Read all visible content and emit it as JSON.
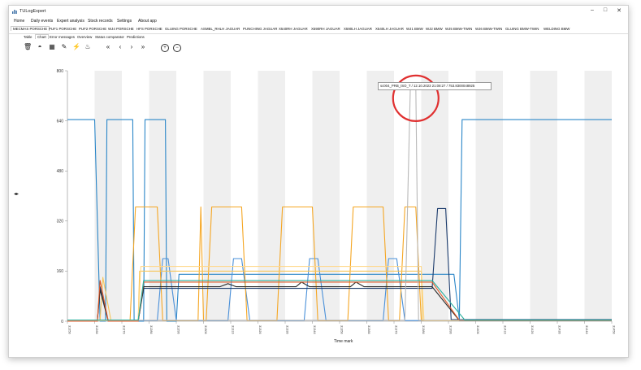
{
  "window": {
    "title": "TULogExpert",
    "controls": [
      "–",
      "□",
      "✕"
    ]
  },
  "menu": [
    "Home",
    "Daily events",
    "Expert analysis",
    "Stock records",
    "Settings",
    "About app"
  ],
  "line_tabs": [
    "MECMAS PORSCHE",
    "PUF1 PORSCHE",
    "PUF2 PORSCHE",
    "WJ4 PORSCHE",
    "HFS PORSCHE",
    "GLUING PORSCHE",
    "ASMBL_RHLH JAGUAR",
    "PUNCHING JAGUAR",
    "X540RH JAGUAR",
    "X590RH JAGUAR",
    "X590LH JAGUAR",
    "X540LH JAGUAR",
    "WJ1 BMW",
    "WJ2 BMW",
    "WJ5 BMW-TWIN",
    "WJ6 BMW-TWIN",
    "GLUING BMW-TWIN",
    "WELDING BMW"
  ],
  "sub_tabs": [
    "Table",
    "Chart",
    "Error messages",
    "Overview",
    "Status comparator",
    "Predictions"
  ],
  "active_sub_tab": "Chart",
  "toolbar_icons": [
    "trash-icon",
    "headset-icon",
    "calendar-icon",
    "edit-icon",
    "bolt-icon",
    "fire-icon",
    "rewind-icon",
    "back-icon",
    "forward-icon",
    "fast-forward-icon",
    "add-icon",
    "minus-icon"
  ],
  "toolbar_glyphs": [
    "🗑",
    "◓",
    "▦",
    "✎",
    "⚡",
    "♨",
    "«",
    "‹",
    "›",
    "»",
    "+",
    "−"
  ],
  "side_handle": "◂▸",
  "tooltip": "sc004_PRB_ISO_T / 12.10.2023 21:08:27 / 753.8300048925",
  "chart_data": {
    "type": "line",
    "xlabel": "Time mark",
    "ylabel": "",
    "yticks": [
      0,
      160,
      320,
      480,
      640,
      800
    ],
    "ylim": [
      0,
      800
    ],
    "xticks": [
      "31256",
      "31266",
      "31276",
      "31286",
      "31296",
      "31306",
      "31316",
      "31326",
      "31336",
      "31346",
      "31356",
      "31366",
      "31376",
      "31386",
      "31396",
      "31406",
      "31416",
      "31426",
      "31436",
      "31446",
      "31456"
    ],
    "xlim": [
      31256,
      31456
    ],
    "grid": "alternating vertical bands",
    "series": [
      {
        "color": "#2a86c8",
        "points": [
          [
            31256,
            644
          ],
          [
            31266,
            644
          ],
          [
            31268,
            0
          ],
          [
            31270,
            0
          ],
          [
            31270.5,
            644
          ],
          [
            31280,
            644
          ],
          [
            31280.5,
            0
          ],
          [
            31284,
            0
          ],
          [
            31284.5,
            644
          ],
          [
            31292,
            644
          ],
          [
            31292.5,
            0
          ],
          [
            31296,
            0
          ],
          [
            31297,
            150
          ],
          [
            31398,
            150
          ],
          [
            31400,
            6
          ],
          [
            31401,
            644
          ],
          [
            31456,
            644
          ]
        ]
      },
      {
        "color": "#4a90d9",
        "points": [
          [
            31256,
            2
          ],
          [
            31282,
            2
          ],
          [
            31289,
            2
          ],
          [
            31291,
            200
          ],
          [
            31293,
            200
          ],
          [
            31296,
            2
          ],
          [
            31315,
            2
          ],
          [
            31317,
            200
          ],
          [
            31320,
            200
          ],
          [
            31323,
            2
          ],
          [
            31343,
            2
          ],
          [
            31345,
            200
          ],
          [
            31348,
            200
          ],
          [
            31351,
            2
          ],
          [
            31372,
            2
          ],
          [
            31374,
            200
          ],
          [
            31377,
            200
          ],
          [
            31380,
            2
          ],
          [
            31389,
            2
          ],
          [
            31456,
            2
          ]
        ]
      },
      {
        "color": "#f5a623",
        "points": [
          [
            31256,
            2
          ],
          [
            31279,
            2
          ],
          [
            31281,
            365
          ],
          [
            31289,
            365
          ],
          [
            31291,
            2
          ],
          [
            31304,
            2
          ],
          [
            31305,
            365
          ],
          [
            31306,
            2
          ],
          [
            31307,
            2
          ],
          [
            31309,
            365
          ],
          [
            31320,
            365
          ],
          [
            31322,
            2
          ],
          [
            31333,
            2
          ],
          [
            31335,
            365
          ],
          [
            31346,
            365
          ],
          [
            31348,
            2
          ],
          [
            31359,
            2
          ],
          [
            31361,
            365
          ],
          [
            31372,
            365
          ],
          [
            31374,
            2
          ],
          [
            31378,
            2
          ],
          [
            31380,
            365
          ],
          [
            31384,
            365
          ],
          [
            31386,
            2
          ],
          [
            31456,
            2
          ]
        ]
      },
      {
        "color": "#f7c65a",
        "points": [
          [
            31256,
            2
          ],
          [
            31268,
            2
          ],
          [
            31269,
            140
          ],
          [
            31272,
            2
          ],
          [
            31282,
            2
          ],
          [
            31282.5,
            160
          ],
          [
            31386,
            160
          ],
          [
            31386.5,
            2
          ],
          [
            31456,
            2
          ]
        ]
      },
      {
        "color": "#ffd88a",
        "points": [
          [
            31256,
            2
          ],
          [
            31282,
            2
          ],
          [
            31283,
            175
          ],
          [
            31386,
            175
          ],
          [
            31387,
            2
          ],
          [
            31456,
            2
          ]
        ]
      },
      {
        "color": "#1a3a6b",
        "points": [
          [
            31256,
            0
          ],
          [
            31267,
            0
          ],
          [
            31268,
            110
          ],
          [
            31271,
            0
          ],
          [
            31282,
            0
          ],
          [
            31284,
            105
          ],
          [
            31390,
            105
          ],
          [
            31392,
            360
          ],
          [
            31395,
            360
          ],
          [
            31397,
            5
          ],
          [
            31456,
            5
          ]
        ]
      },
      {
        "color": "#2c2c2c",
        "points": [
          [
            31256,
            0
          ],
          [
            31267,
            0
          ],
          [
            31268,
            100
          ],
          [
            31271,
            0
          ],
          [
            31282,
            0
          ],
          [
            31284,
            110
          ],
          [
            31312,
            110
          ],
          [
            31315,
            120
          ],
          [
            31318,
            110
          ],
          [
            31340,
            110
          ],
          [
            31342,
            125
          ],
          [
            31345,
            110
          ],
          [
            31360,
            110
          ],
          [
            31362,
            125
          ],
          [
            31365,
            110
          ],
          [
            31390,
            110
          ],
          [
            31400,
            2
          ],
          [
            31456,
            2
          ]
        ]
      },
      {
        "color": "#e05a2a",
        "points": [
          [
            31256,
            0
          ],
          [
            31267,
            0
          ],
          [
            31268,
            130
          ],
          [
            31271,
            0
          ],
          [
            31282,
            0
          ],
          [
            31284,
            125
          ],
          [
            31390,
            125
          ],
          [
            31400,
            3
          ],
          [
            31456,
            3
          ]
        ]
      },
      {
        "color": "#b8b8b8",
        "points": [
          [
            31256,
            3
          ],
          [
            31380,
            3
          ],
          [
            31382,
            750
          ],
          [
            31384,
            750
          ],
          [
            31385,
            3
          ],
          [
            31456,
            3
          ]
        ]
      },
      {
        "color": "#2ab0a0",
        "points": [
          [
            31256,
            4
          ],
          [
            31282,
            4
          ],
          [
            31284,
            130
          ],
          [
            31390,
            130
          ],
          [
            31402,
            4
          ],
          [
            31456,
            4
          ]
        ]
      }
    ]
  }
}
